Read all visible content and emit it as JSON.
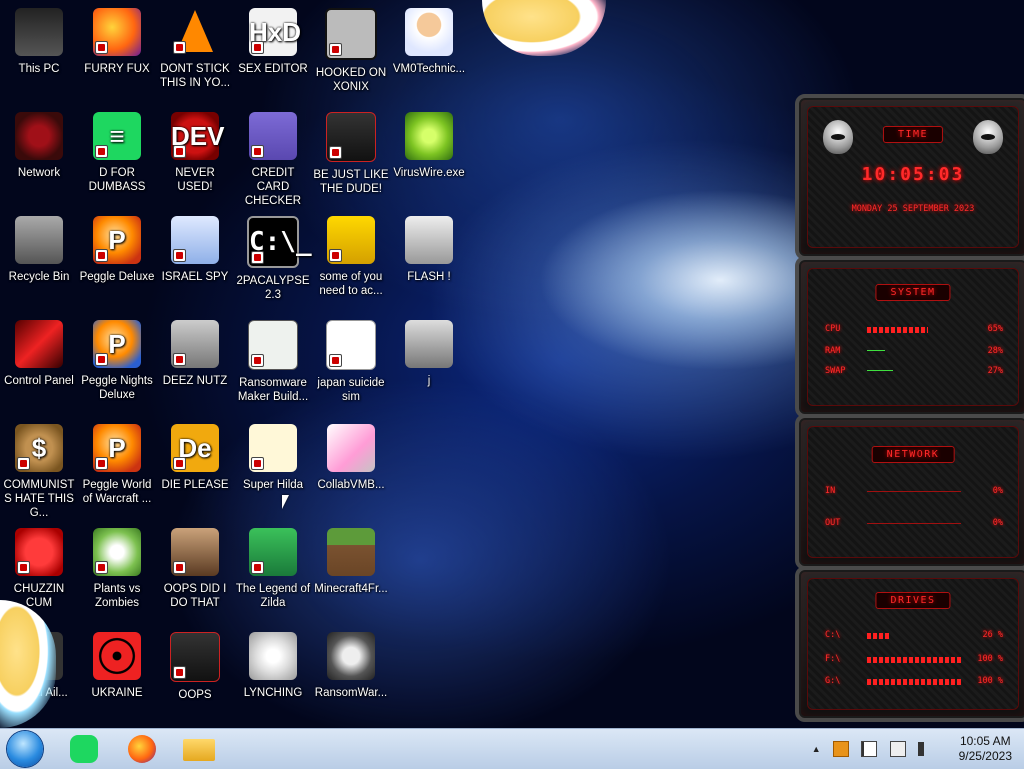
{
  "desktop": {
    "icons": [
      {
        "label": "This PC",
        "icon": "computer-icon"
      },
      {
        "label": "FURRY FUX",
        "icon": "firefox-icon"
      },
      {
        "label": "DONT STICK THIS IN YO...",
        "icon": "vlc-icon"
      },
      {
        "label": "SEX EDITOR",
        "icon": "hex-editor-icon"
      },
      {
        "label": "HOOKED ON XONIX",
        "icon": "game-icon"
      },
      {
        "label": "VM0Technic...",
        "icon": "doctor-icon"
      },
      {
        "label": "Network",
        "icon": "network-icon"
      },
      {
        "label": "D FOR DUMBASS",
        "icon": "spotify-icon"
      },
      {
        "label": "NEVER USED!",
        "icon": "devcpp-icon"
      },
      {
        "label": "CREDIT CARD CHECKER",
        "icon": "credit-card-icon"
      },
      {
        "label": "BE JUST LIKE THE DUDE!",
        "icon": "alien-app-icon"
      },
      {
        "label": "VirusWire.exe",
        "icon": "limewire-icon"
      },
      {
        "label": "Recycle Bin",
        "icon": "recycle-bin-icon"
      },
      {
        "label": "Peggle Deluxe",
        "icon": "peggle-icon"
      },
      {
        "label": "ISRAEL SPY",
        "icon": "spy-icon"
      },
      {
        "label": "2PACALYPSE 2.3",
        "icon": "terminal-icon"
      },
      {
        "label": "some of you need to ac...",
        "icon": "dog-icon"
      },
      {
        "label": "FLASH !",
        "icon": "flash-icon"
      },
      {
        "label": "Control Panel",
        "icon": "control-panel-icon"
      },
      {
        "label": "Peggle Nights Deluxe",
        "icon": "peggle-icon"
      },
      {
        "label": "DEEZ NUTZ",
        "icon": "stack-icon"
      },
      {
        "label": "Ransomware Maker Build...",
        "icon": "window-icon"
      },
      {
        "label": "japan suicide sim",
        "icon": "document-icon"
      },
      {
        "label": "j",
        "icon": "file-icon"
      },
      {
        "label": "COMMUNISTS HATE THIS G...",
        "icon": "money-bag-icon"
      },
      {
        "label": "Peggle World of Warcraft ...",
        "icon": "peggle-icon"
      },
      {
        "label": "DIE PLEASE",
        "icon": "de-icon"
      },
      {
        "label": "Super Hilda",
        "icon": "pixel-game-icon"
      },
      {
        "label": "CollabVMB...",
        "icon": "monitor-icon"
      },
      {
        "label": "CHUZZIN CUM",
        "icon": "chuzzle-icon"
      },
      {
        "label": "Plants vs Zombies",
        "icon": "flower-icon"
      },
      {
        "label": "OOPS DID I DO THAT",
        "icon": "portrait-icon"
      },
      {
        "label": "The Legend of Zilda",
        "icon": "zelda-icon"
      },
      {
        "label": "Minecraft4Fr...",
        "icon": "minecraft-icon"
      },
      {
        "label": "ad Ail...",
        "icon": "app-icon"
      },
      {
        "label": "UKRAINE",
        "icon": "radiation-icon"
      },
      {
        "label": "OOPS",
        "icon": "alien-app-icon"
      },
      {
        "label": "LYNCHING",
        "icon": "chain-icon"
      },
      {
        "label": "RansomWar...",
        "icon": "skull-icon"
      }
    ]
  },
  "widgets": {
    "time": {
      "title": "TIME",
      "clock": "10:05:03",
      "date": "MONDAY 25 SEPTEMBER 2023"
    },
    "system": {
      "title": "SYSTEM",
      "rows": [
        {
          "key": "CPU",
          "value": "65%",
          "fraction": 0.65
        },
        {
          "key": "RAM",
          "value": "28%",
          "fraction": 0.28
        },
        {
          "key": "SWAP",
          "value": "27%",
          "fraction": 0.27
        }
      ]
    },
    "network": {
      "title": "NETWORK",
      "rows": [
        {
          "key": "IN",
          "value": "0%"
        },
        {
          "key": "OUT",
          "value": "0%"
        }
      ]
    },
    "drives": {
      "title": "DRIVES",
      "rows": [
        {
          "key": "C:\\",
          "value": "26 %",
          "fraction": 0.26
        },
        {
          "key": "F:\\",
          "value": "100 %",
          "fraction": 1.0
        },
        {
          "key": "G:\\",
          "value": "100 %",
          "fraction": 1.0
        }
      ]
    },
    "accent_color": "#ff2a2a"
  },
  "taskbar": {
    "pinned": [
      {
        "name": "start-button",
        "icon": "windows-orb-icon"
      },
      {
        "name": "spotify",
        "icon": "spotify-icon"
      },
      {
        "name": "firefox",
        "icon": "firefox-icon"
      },
      {
        "name": "file-explorer",
        "icon": "folder-icon"
      }
    ],
    "tray": {
      "show_hidden": "▲",
      "time": "10:05 AM",
      "date": "9/25/2023"
    }
  }
}
